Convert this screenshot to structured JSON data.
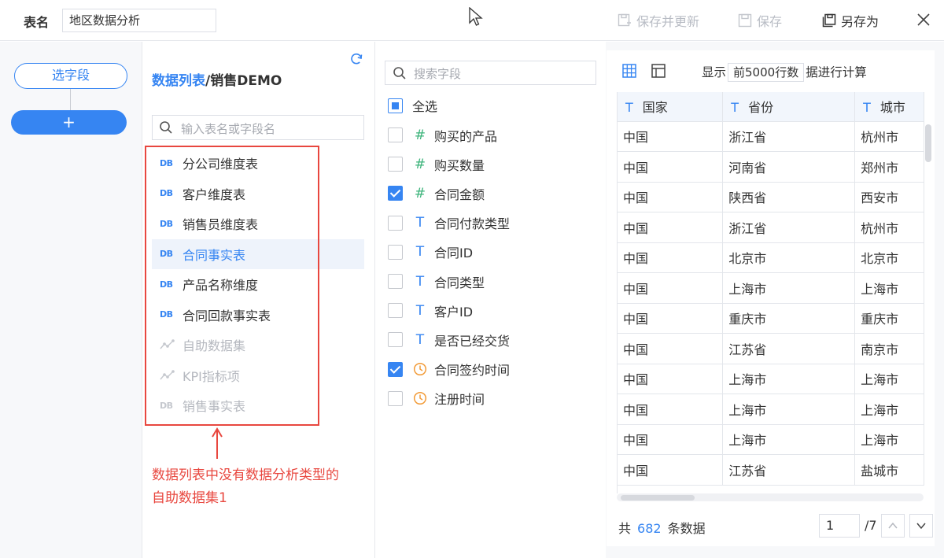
{
  "header": {
    "name_label": "表名",
    "name_value": "地区数据分析",
    "save_update": "保存并更新",
    "save": "保存",
    "save_as": "另存为"
  },
  "left": {
    "pick_fields": "选字段",
    "add": "+"
  },
  "tables": {
    "breadcrumb_root": "数据列表",
    "breadcrumb_sep": "/",
    "breadcrumb_current": "销售DEMO",
    "search_placeholder": "输入表名或字段名",
    "items": [
      {
        "label": "分公司维度表",
        "icon": "DB"
      },
      {
        "label": "客户维度表",
        "icon": "DB"
      },
      {
        "label": "销售员维度表",
        "icon": "DB"
      },
      {
        "label": "合同事实表",
        "icon": "DB"
      },
      {
        "label": "产品名称维度",
        "icon": "DB"
      },
      {
        "label": "合同回款事实表",
        "icon": "DB"
      },
      {
        "label": "自助数据集",
        "icon": "analysis-icon"
      },
      {
        "label": "KPI指标项",
        "icon": "analysis-icon"
      },
      {
        "label": "销售事实表",
        "icon": "DB"
      }
    ],
    "annotation": "数据列表中没有数据分析类型的自助数据集1"
  },
  "fields": {
    "search_placeholder": "搜索字段",
    "select_all": "全选",
    "items": [
      {
        "label": "购买的产品",
        "type": "#",
        "checked": false
      },
      {
        "label": "购买数量",
        "type": "#",
        "checked": false
      },
      {
        "label": "合同金额",
        "type": "#",
        "checked": true
      },
      {
        "label": "合同付款类型",
        "type": "T",
        "checked": false
      },
      {
        "label": "合同ID",
        "type": "T",
        "checked": false
      },
      {
        "label": "合同类型",
        "type": "T",
        "checked": false
      },
      {
        "label": "客户ID",
        "type": "T",
        "checked": false
      },
      {
        "label": "是否已经交货",
        "type": "T",
        "checked": false
      },
      {
        "label": "合同签约时间",
        "type": "date",
        "checked": true
      },
      {
        "label": "注册时间",
        "type": "date",
        "checked": false
      }
    ]
  },
  "preview": {
    "info_prefix": "显示",
    "info_select": "前5000行数",
    "info_suffix": "据进行计算",
    "columns": [
      "国家",
      "省份",
      "城市"
    ],
    "rows": [
      [
        "中国",
        "浙江省",
        "杭州市"
      ],
      [
        "中国",
        "河南省",
        "郑州市"
      ],
      [
        "中国",
        "陕西省",
        "西安市"
      ],
      [
        "中国",
        "浙江省",
        "杭州市"
      ],
      [
        "中国",
        "北京市",
        "北京市"
      ],
      [
        "中国",
        "上海市",
        "上海市"
      ],
      [
        "中国",
        "重庆市",
        "重庆市"
      ],
      [
        "中国",
        "江苏省",
        "南京市"
      ],
      [
        "中国",
        "上海市",
        "上海市"
      ],
      [
        "中国",
        "上海市",
        "上海市"
      ],
      [
        "中国",
        "上海市",
        "上海市"
      ],
      [
        "中国",
        "江苏省",
        "盐城市"
      ]
    ],
    "count_prefix": "共",
    "count": "682",
    "count_suffix": "条数据",
    "page": "1",
    "page_total": "/7"
  },
  "colors": {
    "accent": "#3685f2",
    "annotation": "#e8473f",
    "number_type": "#3bb37a",
    "date_type": "#f29b38"
  }
}
